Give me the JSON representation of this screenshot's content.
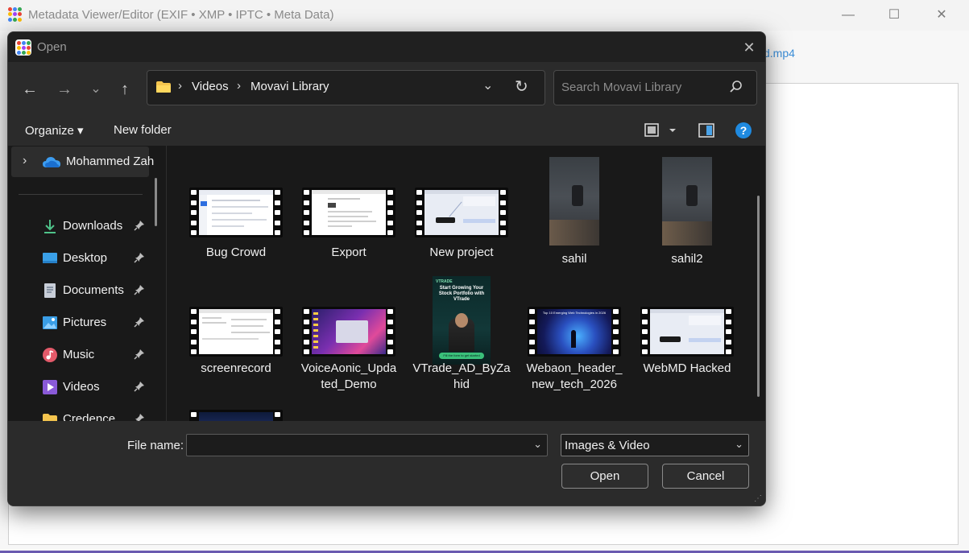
{
  "background_app": {
    "title": "Metadata Viewer/Editor (EXIF • XMP • IPTC • Meta Data)",
    "file_link_text": "d.mp4",
    "logo_colors": [
      "#ea4335",
      "#4285f4",
      "#34a853",
      "#fbbc05",
      "#a142f4",
      "#ea4335",
      "#4285f4",
      "#34a853",
      "#fbbc05"
    ],
    "window_controls": {
      "minimize": "—",
      "maximize": "☐",
      "close": "✕"
    }
  },
  "dialog": {
    "title": "Open",
    "close_glyph": "✕",
    "nav": {
      "back": "←",
      "forward": "→",
      "recent": "⌄",
      "up": "↑"
    },
    "address": {
      "segments": [
        "Videos",
        "Movavi Library"
      ],
      "separator": "›",
      "dropdown": "⌄",
      "refresh": "↻"
    },
    "search": {
      "placeholder": "Search Movavi Library"
    },
    "toolbar": {
      "organize_label": "Organize ▾",
      "new_folder_label": "New folder",
      "help_glyph": "?"
    },
    "nav_pane": {
      "top_item": {
        "chevron": "›",
        "label": "Mohammed Zah"
      },
      "items": [
        {
          "label": "Downloads",
          "icon": "download-icon"
        },
        {
          "label": "Desktop",
          "icon": "desktop-icon"
        },
        {
          "label": "Documents",
          "icon": "documents-icon"
        },
        {
          "label": "Pictures",
          "icon": "pictures-icon"
        },
        {
          "label": "Music",
          "icon": "music-icon"
        },
        {
          "label": "Videos",
          "icon": "videos-icon"
        },
        {
          "label": "Credence",
          "icon": "folder-icon"
        }
      ]
    },
    "files": [
      {
        "name": "Bug Crowd",
        "kind": "video"
      },
      {
        "name": "Export",
        "kind": "video"
      },
      {
        "name": "New project",
        "kind": "video"
      },
      {
        "name": "sahil",
        "kind": "portrait"
      },
      {
        "name": "sahil2",
        "kind": "portrait"
      },
      {
        "name": "screenrecord",
        "kind": "video"
      },
      {
        "name": "VoiceAonic_Updated_Demo",
        "name_lines": [
          "VoiceAonic_Upda",
          "ted_Demo"
        ],
        "kind": "video"
      },
      {
        "name": "VTrade_AD_ByZahid",
        "name_lines": [
          "VTrade_AD_ByZa",
          "hid"
        ],
        "kind": "poster"
      },
      {
        "name": "Webaon_header_new_tech_2026",
        "name_lines": [
          "Webaon_header_",
          "new_tech_2026"
        ],
        "kind": "video"
      },
      {
        "name": "WebMD Hacked",
        "kind": "video"
      }
    ],
    "poster": {
      "brand": "VTRADE",
      "headline": "Start Growing Your Stock Portfolio with VTrade",
      "cta": "Fill the form to get started"
    },
    "thumbnail_texts": {
      "webaon": "Top 10 Emerging Web Technologies in 2026"
    },
    "footer": {
      "file_name_label": "File name:",
      "file_name_value": "",
      "file_type_selected": "Images & Video",
      "open_label": "Open",
      "cancel_label": "Cancel"
    }
  }
}
